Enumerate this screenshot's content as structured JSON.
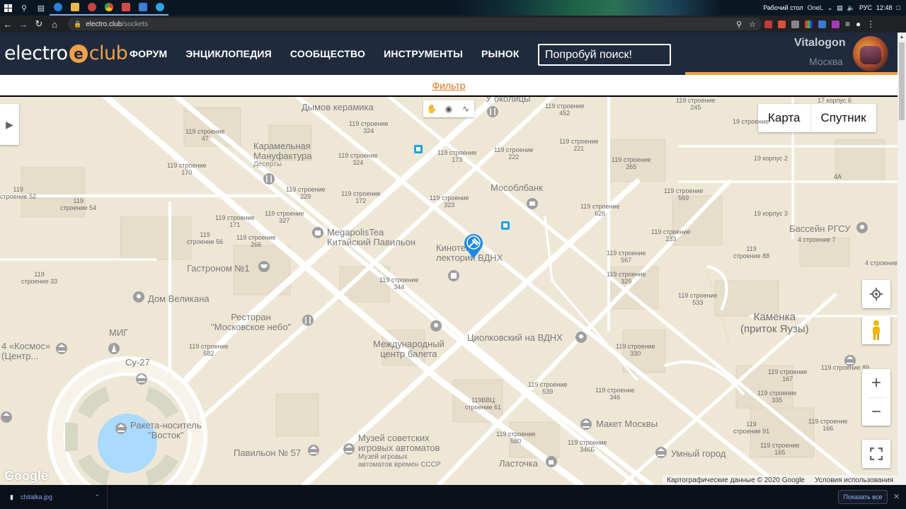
{
  "taskbar": {
    "desktop_label": "Рабочий стол",
    "onedrive_label": "OneL",
    "language": "РУС",
    "time": "12:48"
  },
  "browser": {
    "url_host": "electro.club",
    "url_path": "/sockets"
  },
  "site": {
    "logo_left": "electro",
    "logo_badge": "e",
    "logo_right": "club",
    "nav": [
      "ФОРУМ",
      "ЭНЦИКЛОПЕДИЯ",
      "СООБЩЕСТВО",
      "ИНСТРУМЕНТЫ",
      "РЫНОК"
    ],
    "search_placeholder": "Попробуй поиск!",
    "user_name": "Vitalogon",
    "user_city": "Москва",
    "filter_label": "Фильтр"
  },
  "map": {
    "type_buttons": [
      "Карта",
      "Спутник"
    ],
    "footer_data": "Картографические данные © 2020 Google",
    "footer_terms": "Условия использования",
    "google_logo": "Google",
    "pois": [
      {
        "text": "Дымов керамика"
      },
      {
        "text": "Карамельная\nМануфактура"
      },
      {
        "text": "Десерты"
      },
      {
        "text": "MegapolisTea\nКитайский Павильон"
      },
      {
        "text": "Гастроном №1"
      },
      {
        "text": "Дом Великана"
      },
      {
        "text": "Ресторан\n\"Московское небо\""
      },
      {
        "text": "МИГ"
      },
      {
        "text": "Су-27"
      },
      {
        "text": "4 «Космос»\n(Центр..."
      },
      {
        "text": "Ракета-носитель\n\"Восток\""
      },
      {
        "text": "Павильон № 57"
      },
      {
        "text": "Музей советских\nигровых автоматов"
      },
      {
        "text": "Музей игровых\nавтоматов времен СССР"
      },
      {
        "text": "Международный\nцентр балета"
      },
      {
        "text": "Циолковский на ВДНХ"
      },
      {
        "text": "Кинотеатр\nлекторий ВДНХ"
      },
      {
        "text": "Мособлбанк"
      },
      {
        "text": "У околицы"
      },
      {
        "text": "Макет Москвы"
      },
      {
        "text": "Умный город"
      },
      {
        "text": "Ласточка"
      },
      {
        "text": "Бассейн РГСУ"
      },
      {
        "text": "4 строение 7"
      },
      {
        "text": "Каменка\n(приток Яузы)"
      }
    ],
    "labels": [
      {
        "text": "119 строение\n452"
      },
      {
        "text": "119 строение\n245"
      },
      {
        "text": "17 корпус 6"
      },
      {
        "text": "119 строение\n47"
      },
      {
        "text": "119 строение\n324"
      },
      {
        "text": "119 строение\n324"
      },
      {
        "text": "119 строение\n173"
      },
      {
        "text": "119 строение\n222"
      },
      {
        "text": "119 строение\n221"
      },
      {
        "text": "119 строение\n265"
      },
      {
        "text": "19 строение"
      },
      {
        "text": "19 корпус 2"
      },
      {
        "text": "119 строение\n170"
      },
      {
        "text": "119\nстроение 52"
      },
      {
        "text": "119 строение\n229"
      },
      {
        "text": "119 строение\n172"
      },
      {
        "text": "119 строение\n323"
      },
      {
        "text": "119 строение\n569"
      },
      {
        "text": "4А"
      },
      {
        "text": "119\nстроение 54"
      },
      {
        "text": "119 строение\n626"
      },
      {
        "text": "19 корпус 3"
      },
      {
        "text": "119 строение\n171"
      },
      {
        "text": "119 строение\n327"
      },
      {
        "text": "119\nстроение 56"
      },
      {
        "text": "119 строение\n266"
      },
      {
        "text": "119 строение\n233"
      },
      {
        "text": "119\nстроение 88"
      },
      {
        "text": "119 строение\n567"
      },
      {
        "text": "4 строение"
      },
      {
        "text": "119\nстроение 33"
      },
      {
        "text": "119 строение\n344"
      },
      {
        "text": "119 строение\n329"
      },
      {
        "text": "119 строение\n533"
      },
      {
        "text": "119 строение\n582"
      },
      {
        "text": "119 строение\n330"
      },
      {
        "text": "119 строение 89"
      },
      {
        "text": "119 строение\n167"
      },
      {
        "text": "119 строение\n539"
      },
      {
        "text": "119 строение\n346"
      },
      {
        "text": "119ВВЦ\nстроение 61"
      },
      {
        "text": "119 строение\n335"
      },
      {
        "text": "119\nстроение 91"
      },
      {
        "text": "119 строение\n166"
      },
      {
        "text": "119 строение\n580"
      },
      {
        "text": "119 строение\n346Б"
      },
      {
        "text": "119 строение\n165"
      }
    ]
  },
  "downloads": {
    "file_name": "chitalka.jpg",
    "show_all": "Показать все"
  }
}
